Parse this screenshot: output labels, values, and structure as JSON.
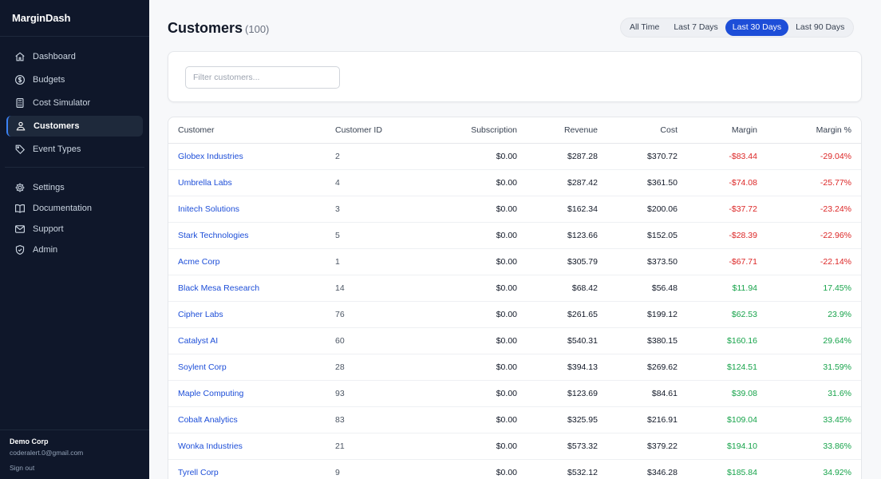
{
  "app": {
    "name": "MarginDash"
  },
  "sidebar": {
    "items": [
      {
        "label": "Dashboard",
        "icon": "home-icon"
      },
      {
        "label": "Budgets",
        "icon": "dollar-circle-icon"
      },
      {
        "label": "Cost Simulator",
        "icon": "calculator-icon"
      },
      {
        "label": "Customers",
        "icon": "users-icon",
        "active": true
      },
      {
        "label": "Event Types",
        "icon": "tag-icon"
      }
    ],
    "secondary": [
      {
        "label": "Settings",
        "icon": "gear-icon"
      },
      {
        "label": "Documentation",
        "icon": "book-icon"
      },
      {
        "label": "Support",
        "icon": "mail-icon"
      },
      {
        "label": "Admin",
        "icon": "shield-icon"
      }
    ],
    "user": {
      "org": "Demo Corp",
      "email": "coderalert.0@gmail.com",
      "signout": "Sign out"
    }
  },
  "header": {
    "title": "Customers",
    "count": "(100)",
    "ranges": [
      "All Time",
      "Last 7 Days",
      "Last 30 Days",
      "Last 90 Days"
    ],
    "active_range": "Last 30 Days"
  },
  "filter": {
    "placeholder": "Filter customers..."
  },
  "table": {
    "columns": [
      "Customer",
      "Customer ID",
      "Subscription",
      "Revenue",
      "Cost",
      "Margin",
      "Margin %"
    ],
    "rows": [
      [
        "Globex Industries",
        "2",
        "$0.00",
        "$287.28",
        "$370.72",
        "-$83.44",
        "-29.04%"
      ],
      [
        "Umbrella Labs",
        "4",
        "$0.00",
        "$287.42",
        "$361.50",
        "-$74.08",
        "-25.77%"
      ],
      [
        "Initech Solutions",
        "3",
        "$0.00",
        "$162.34",
        "$200.06",
        "-$37.72",
        "-23.24%"
      ],
      [
        "Stark Technologies",
        "5",
        "$0.00",
        "$123.66",
        "$152.05",
        "-$28.39",
        "-22.96%"
      ],
      [
        "Acme Corp",
        "1",
        "$0.00",
        "$305.79",
        "$373.50",
        "-$67.71",
        "-22.14%"
      ],
      [
        "Black Mesa Research",
        "14",
        "$0.00",
        "$68.42",
        "$56.48",
        "$11.94",
        "17.45%"
      ],
      [
        "Cipher Labs",
        "76",
        "$0.00",
        "$261.65",
        "$199.12",
        "$62.53",
        "23.9%"
      ],
      [
        "Catalyst AI",
        "60",
        "$0.00",
        "$540.31",
        "$380.15",
        "$160.16",
        "29.64%"
      ],
      [
        "Soylent Corp",
        "28",
        "$0.00",
        "$394.13",
        "$269.62",
        "$124.51",
        "31.59%"
      ],
      [
        "Maple Computing",
        "93",
        "$0.00",
        "$123.69",
        "$84.61",
        "$39.08",
        "31.6%"
      ],
      [
        "Cobalt Analytics",
        "83",
        "$0.00",
        "$325.95",
        "$216.91",
        "$109.04",
        "33.45%"
      ],
      [
        "Wonka Industries",
        "21",
        "$0.00",
        "$573.32",
        "$379.22",
        "$194.10",
        "33.86%"
      ],
      [
        "Tyrell Corp",
        "9",
        "$0.00",
        "$532.12",
        "$346.28",
        "$185.84",
        "34.92%"
      ]
    ]
  },
  "colors": {
    "accent": "#1d4ed8",
    "negative": "#dc2626",
    "positive": "#16a34a",
    "sidebar_bg": "#0f172a"
  }
}
